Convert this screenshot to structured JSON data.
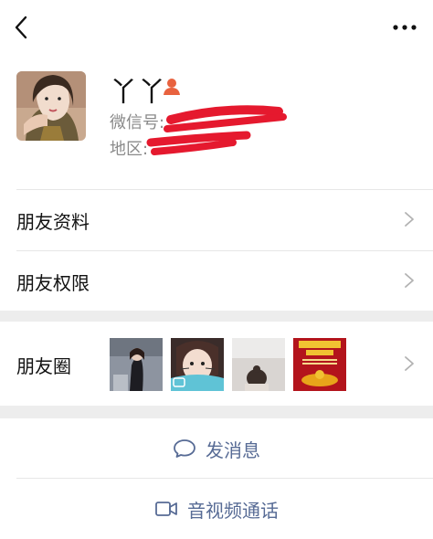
{
  "profile": {
    "name": "丫丫",
    "wechat_id_label": "微信号:",
    "region_label": "地区:"
  },
  "menu": {
    "items": [
      {
        "label": "朋友资料"
      },
      {
        "label": "朋友权限"
      }
    ]
  },
  "moments": {
    "label": "朋友圈"
  },
  "actions": {
    "send_message": "发消息",
    "video_call": "音视频通话"
  },
  "colors": {
    "link": "#576b95",
    "section_gap": "#ededed",
    "redaction": "#e5192e",
    "person_icon": "#e8623f"
  },
  "icons": [
    "back-arrow-icon",
    "more-dots-icon",
    "person-icon",
    "chevron-right-icon",
    "chat-bubble-icon",
    "video-camera-icon"
  ]
}
